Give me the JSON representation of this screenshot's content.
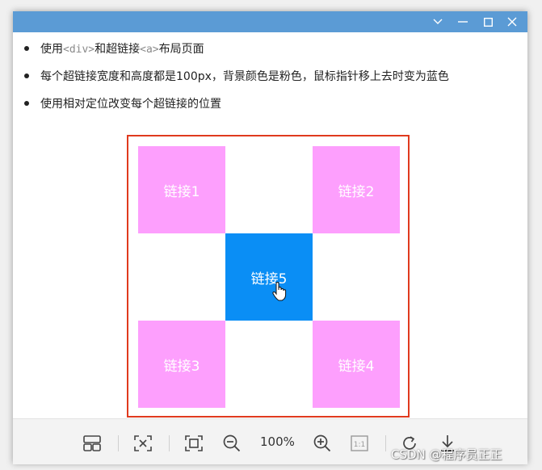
{
  "bullets": {
    "b1_pre": "使用",
    "b1_code1": "<div>",
    "b1_mid": "和超链接",
    "b1_code2": "<a>",
    "b1_post": "布局页面",
    "b2": "每个超链接宽度和高度都是100px，背景颜色是粉色，鼠标指针移上去时变为蓝色",
    "b3": "使用相对定位改变每个超链接的位置"
  },
  "demo": {
    "links": [
      "链接1",
      "链接2",
      "链接5",
      "链接3",
      "链接4"
    ],
    "colors": {
      "pink": "#fd9ffd",
      "blue": "#0a8ef5",
      "border": "#e03a1e"
    }
  },
  "toolbar": {
    "zoom": "100%",
    "icons": [
      "layout-icon",
      "fit-window-icon",
      "fullscreen-icon",
      "zoom-out-icon",
      "zoom-in-icon",
      "actual-size-icon",
      "rotate-icon",
      "download-icon"
    ]
  },
  "window": {
    "titlebar_color": "#5b9bd5",
    "icons": [
      "chevron-down-icon",
      "minimize-icon",
      "maximize-icon",
      "close-icon"
    ]
  },
  "watermark": "CSDN @程序员正正"
}
